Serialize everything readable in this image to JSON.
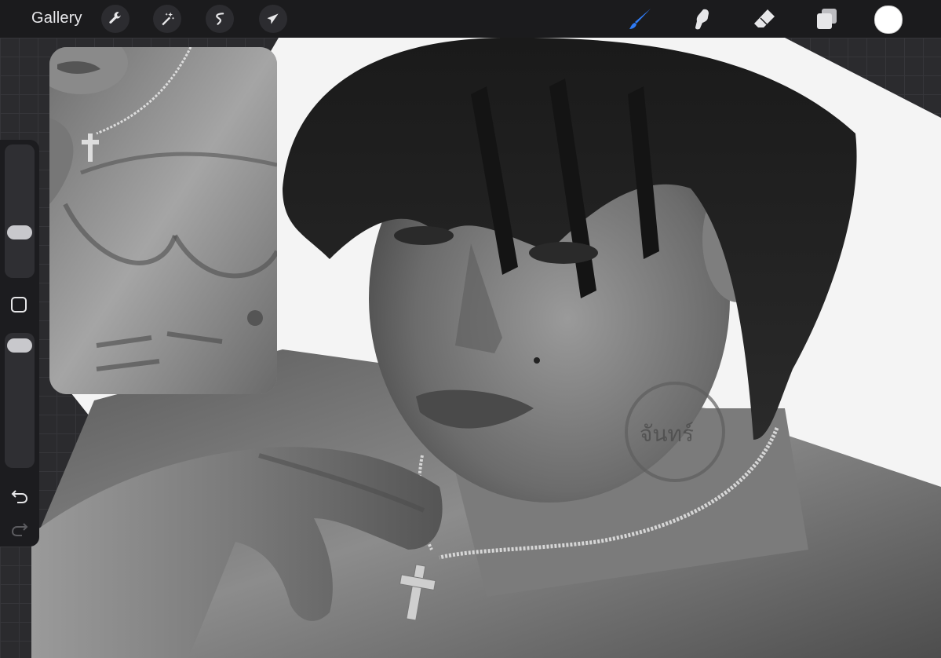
{
  "toolbar": {
    "gallery_label": "Gallery",
    "left_tools": [
      "wrench-icon",
      "magic-wand-icon",
      "selection-icon",
      "transform-arrow-icon"
    ],
    "right_tools": [
      "brush-icon",
      "smudge-icon",
      "eraser-icon",
      "layers-icon"
    ],
    "active_tool": "brush-icon",
    "accent_color": "#2f7bf5",
    "current_color": "#ffffff"
  },
  "sidebar": {
    "brush_size_level": 0.45,
    "opacity_level": 0.96,
    "icons": [
      "modify-square-icon",
      "undo-icon",
      "redo-icon"
    ]
  },
  "canvas": {
    "tattoo_text": "จันทร์"
  }
}
